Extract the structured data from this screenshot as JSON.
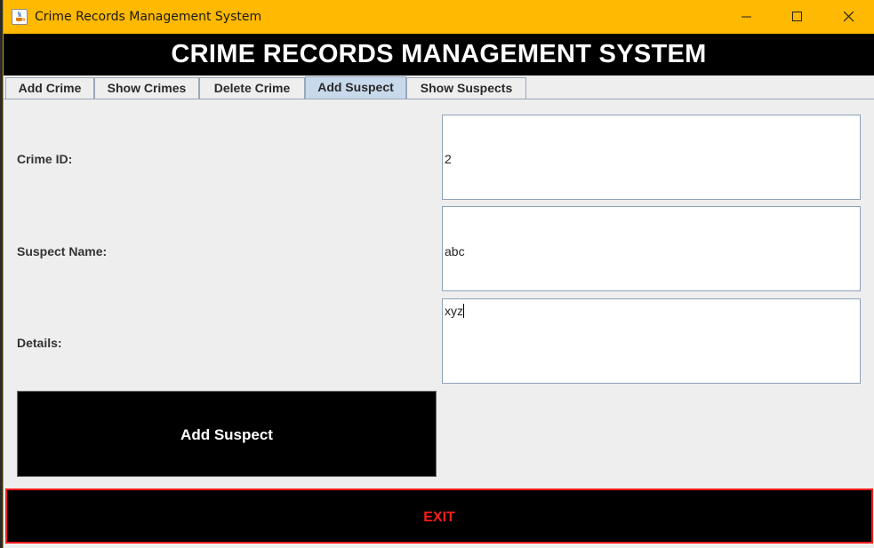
{
  "window": {
    "title": "Crime Records Management System",
    "icon": "java-cup-icon",
    "controls": [
      "minimize-icon",
      "maximize-icon",
      "close-icon"
    ]
  },
  "header": {
    "title": "CRIME RECORDS MANAGEMENT SYSTEM"
  },
  "tabs": [
    {
      "label": "Add Crime"
    },
    {
      "label": "Show Crimes"
    },
    {
      "label": "Delete Crime"
    },
    {
      "label": "Add Suspect",
      "active": true
    },
    {
      "label": "Show Suspects"
    }
  ],
  "form": {
    "crime_id": {
      "label": "Crime ID:",
      "value": "2"
    },
    "suspect_name": {
      "label": "Suspect Name:",
      "value": "abc"
    },
    "details": {
      "label": "Details:",
      "value": "xyz"
    }
  },
  "buttons": {
    "add_suspect": "Add Suspect",
    "exit": "EXIT"
  },
  "colors": {
    "titlebar": "#ffb900",
    "banner": "#000000",
    "active_tab": "#c8d9ec",
    "exit_text": "#ff1a1a"
  }
}
